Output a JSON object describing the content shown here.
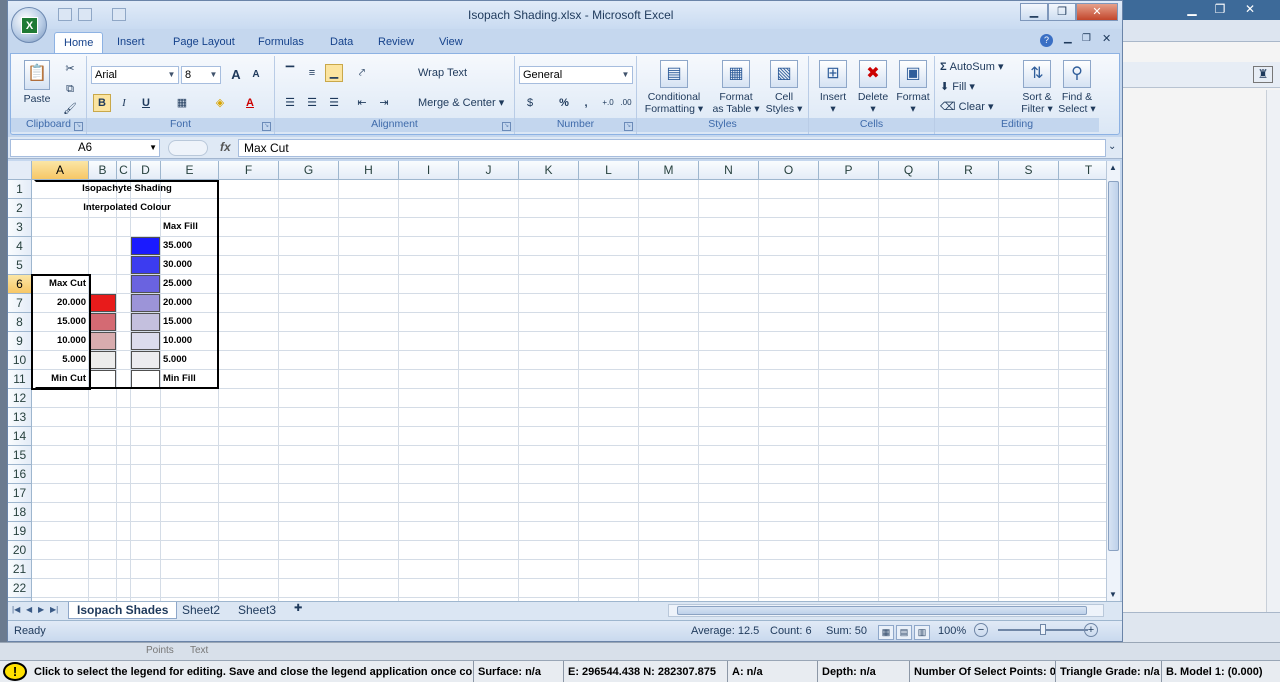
{
  "window": {
    "title": "Isopach Shading.xlsx - Microsoft Excel"
  },
  "ribbon": {
    "tabs": [
      "Home",
      "Insert",
      "Page Layout",
      "Formulas",
      "Data",
      "Review",
      "View"
    ],
    "active_tab": "Home",
    "clipboard": {
      "paste": "Paste",
      "group": "Clipboard"
    },
    "font": {
      "name": "Arial",
      "size": "8",
      "group": "Font",
      "bold": "B",
      "italic": "I",
      "underline": "U",
      "grow": "A",
      "shrink": "A",
      "color": "A"
    },
    "alignment": {
      "wrap": "Wrap Text",
      "merge": "Merge & Center",
      "group": "Alignment"
    },
    "number": {
      "format": "General",
      "percent": "%",
      "comma": ",",
      "group": "Number"
    },
    "styles": {
      "conditional": [
        "Conditional",
        "Formatting"
      ],
      "format_table": [
        "Format",
        "as Table"
      ],
      "cell_styles": [
        "Cell",
        "Styles"
      ],
      "group": "Styles"
    },
    "cells": {
      "insert": "Insert",
      "delete": "Delete",
      "format": "Format",
      "group": "Cells"
    },
    "editing": {
      "autosum": "AutoSum",
      "fill": "Fill",
      "clear": "Clear",
      "sort": [
        "Sort &",
        "Filter"
      ],
      "find": [
        "Find &",
        "Select"
      ],
      "group": "Editing"
    }
  },
  "formula_bar": {
    "name_box": "A6",
    "fx": "fx",
    "formula": "Max Cut"
  },
  "grid": {
    "columns": [
      "A",
      "B",
      "C",
      "D",
      "E",
      "F",
      "G",
      "H",
      "I",
      "J",
      "K",
      "L",
      "M",
      "N",
      "O",
      "P",
      "Q",
      "R",
      "S",
      "T"
    ],
    "rows": [
      "1",
      "2",
      "3",
      "4",
      "5",
      "6",
      "7",
      "8",
      "9",
      "10",
      "11",
      "12",
      "13",
      "14",
      "15",
      "16",
      "17",
      "18",
      "19",
      "20",
      "21",
      "22",
      "23"
    ],
    "selected_col": "A",
    "selected_row": "6"
  },
  "legend": {
    "title1": "Isopachyte Shading",
    "title2": "Interpolated Colour",
    "max_fill": "Max Fill",
    "max_cut": "Max Cut",
    "min_cut": "Min Cut",
    "min_fill": "Min Fill",
    "fill_values": [
      "35.000",
      "30.000",
      "25.000",
      "20.000",
      "15.000",
      "10.000",
      "5.000"
    ],
    "cut_values": [
      "20.000",
      "15.000",
      "10.000",
      "5.000"
    ],
    "fill_colors": [
      "#1a1aff",
      "#3c3cf0",
      "#6a63e0",
      "#9c94d8",
      "#c4c0de",
      "#dcdcec",
      "#ececf0",
      "#ffffff"
    ],
    "cut_colors": [
      "#e81b1b",
      "#d46a73",
      "#d8acae",
      "#ececec",
      "#ffffff"
    ]
  },
  "sheets": {
    "tabs": [
      "Isopach Shades",
      "Sheet2",
      "Sheet3"
    ],
    "active": "Isopach Shades"
  },
  "status": {
    "ready": "Ready",
    "average": "Average: 12.5",
    "count": "Count: 6",
    "sum": "Sum: 50",
    "zoom": "100%"
  },
  "background": {
    "tab1": "Points",
    "tab2": "Text"
  },
  "app_status": {
    "warn_icon": "!",
    "message": "Click to select the legend for editing.  Save and close the legend application once comp",
    "surface": "Surface: n/a",
    "coords": "E: 296544.438  N: 282307.875",
    "a": "A: n/a",
    "depth": "Depth: n/a",
    "select_points": "Number Of Select Points: 0",
    "triangle": "Triangle Grade: n/a",
    "model": "B. Model 1: (0.000)"
  }
}
